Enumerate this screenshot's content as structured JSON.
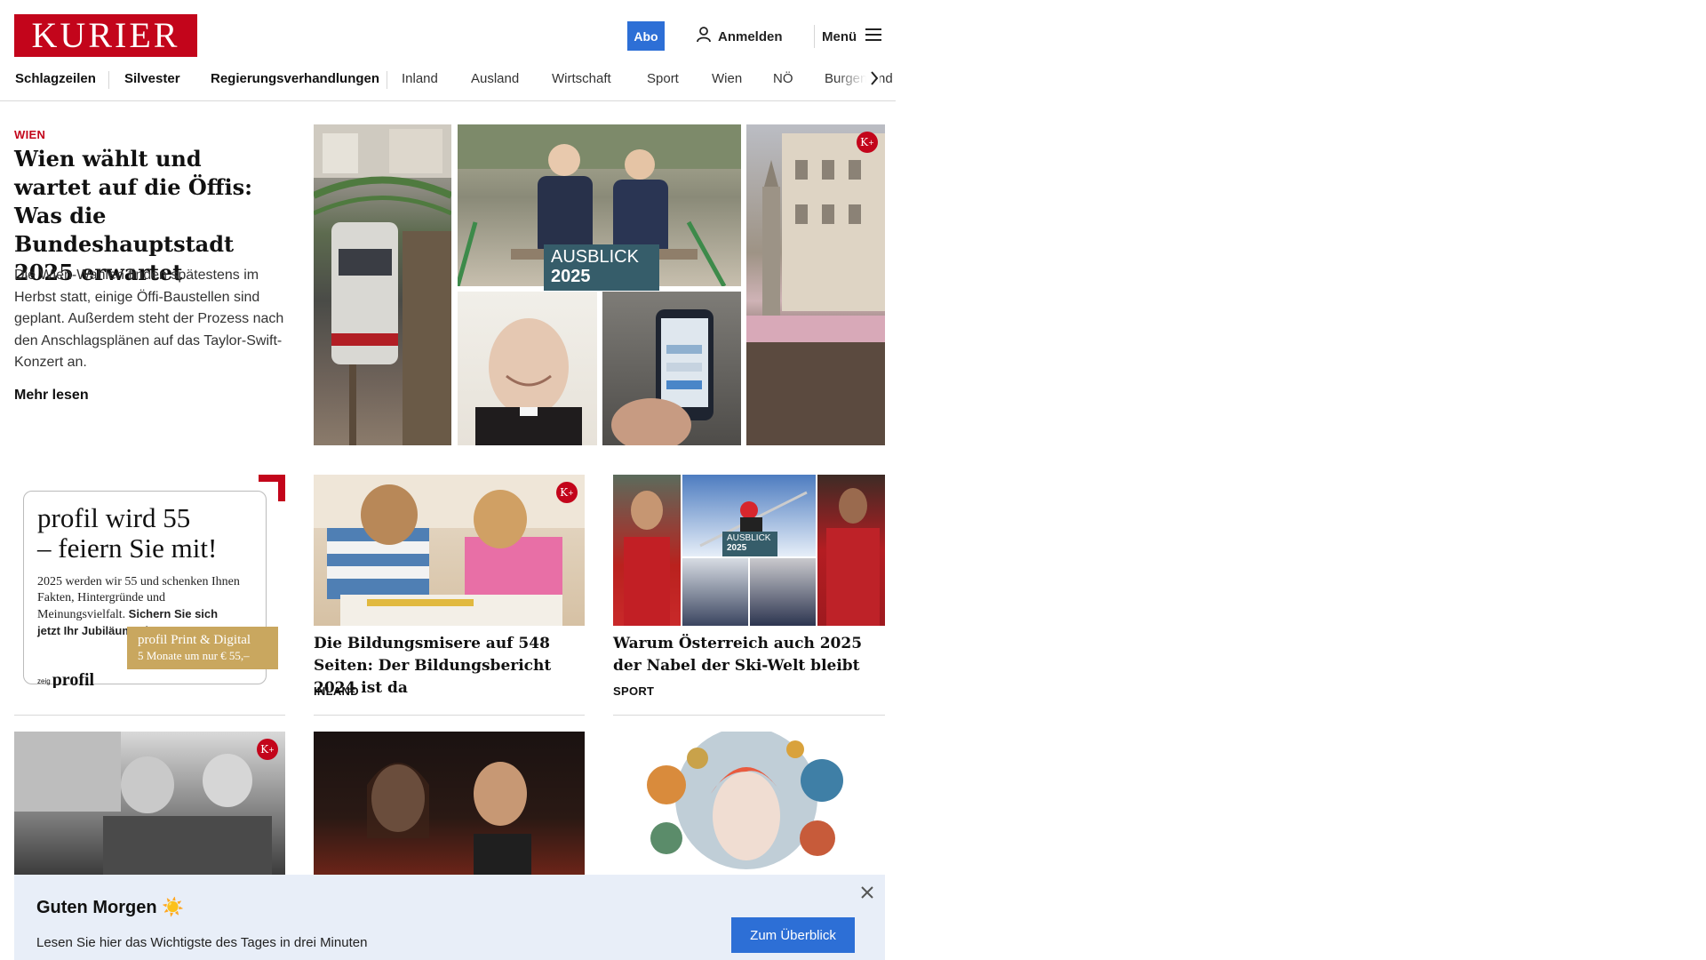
{
  "header": {
    "logo_text": "KURIER",
    "abo_label": "Abo",
    "login_label": "Anmelden",
    "menu_label": "Menü"
  },
  "nav": {
    "items": [
      "Schlagzeilen",
      "Silvester",
      "Regierungsverhandlungen",
      "Inland",
      "Ausland",
      "Wirtschaft",
      "Sport",
      "Wien",
      "NÖ",
      "Burgenland"
    ]
  },
  "lead": {
    "category": "WIEN",
    "title": "Wien wählt und wartet auf die Öffis: Was die Bundeshauptstadt 2025 erwartet",
    "teaser": "Die Wien-Wahlen finden spätestens im Herbst statt, einige Öffi-Baustellen sind geplant. Außerdem steht der Prozess nach den Anschlagsplänen auf das Taylor-Swift-Konzert an.",
    "more": "Mehr lesen",
    "badge_word": "AUSBLICK",
    "badge_year": "2025"
  },
  "ad": {
    "headline_1": "profil wird 55",
    "headline_2": "– feiern Sie mit!",
    "body": "2025 werden wir 55 und schenken Ihnen Fakten, Hintergründe und Meinungsvielfalt.",
    "body_bold": "Sichern Sie sich jetzt Ihr Jubiläumsabo!",
    "cta_title": "profil Print & Digital",
    "cta_sub": "5 Monate um nur € 55,–",
    "logo_prefix": "zeig",
    "logo": "profil"
  },
  "cards": [
    {
      "title": "Die Bildungsmisere auf 548 Seiten: Der Bildungsbericht 2024 ist da",
      "category": "INLAND"
    },
    {
      "title": "Warum Österreich auch 2025 der Nabel der Ski-Welt bleibt",
      "category": "SPORT"
    }
  ],
  "sport_badge": {
    "word": "AUSBLICK",
    "year": "2025"
  },
  "kplus_label": "K",
  "banner": {
    "title": "Guten Morgen ☀️",
    "text": "Lesen Sie hier das Wichtigste des Tages in drei Minuten",
    "button": "Zum Überblick"
  },
  "colors": {
    "brand_red": "#c3051b",
    "button_blue": "#2d6fd6",
    "banner_bg": "#e8eef8"
  }
}
